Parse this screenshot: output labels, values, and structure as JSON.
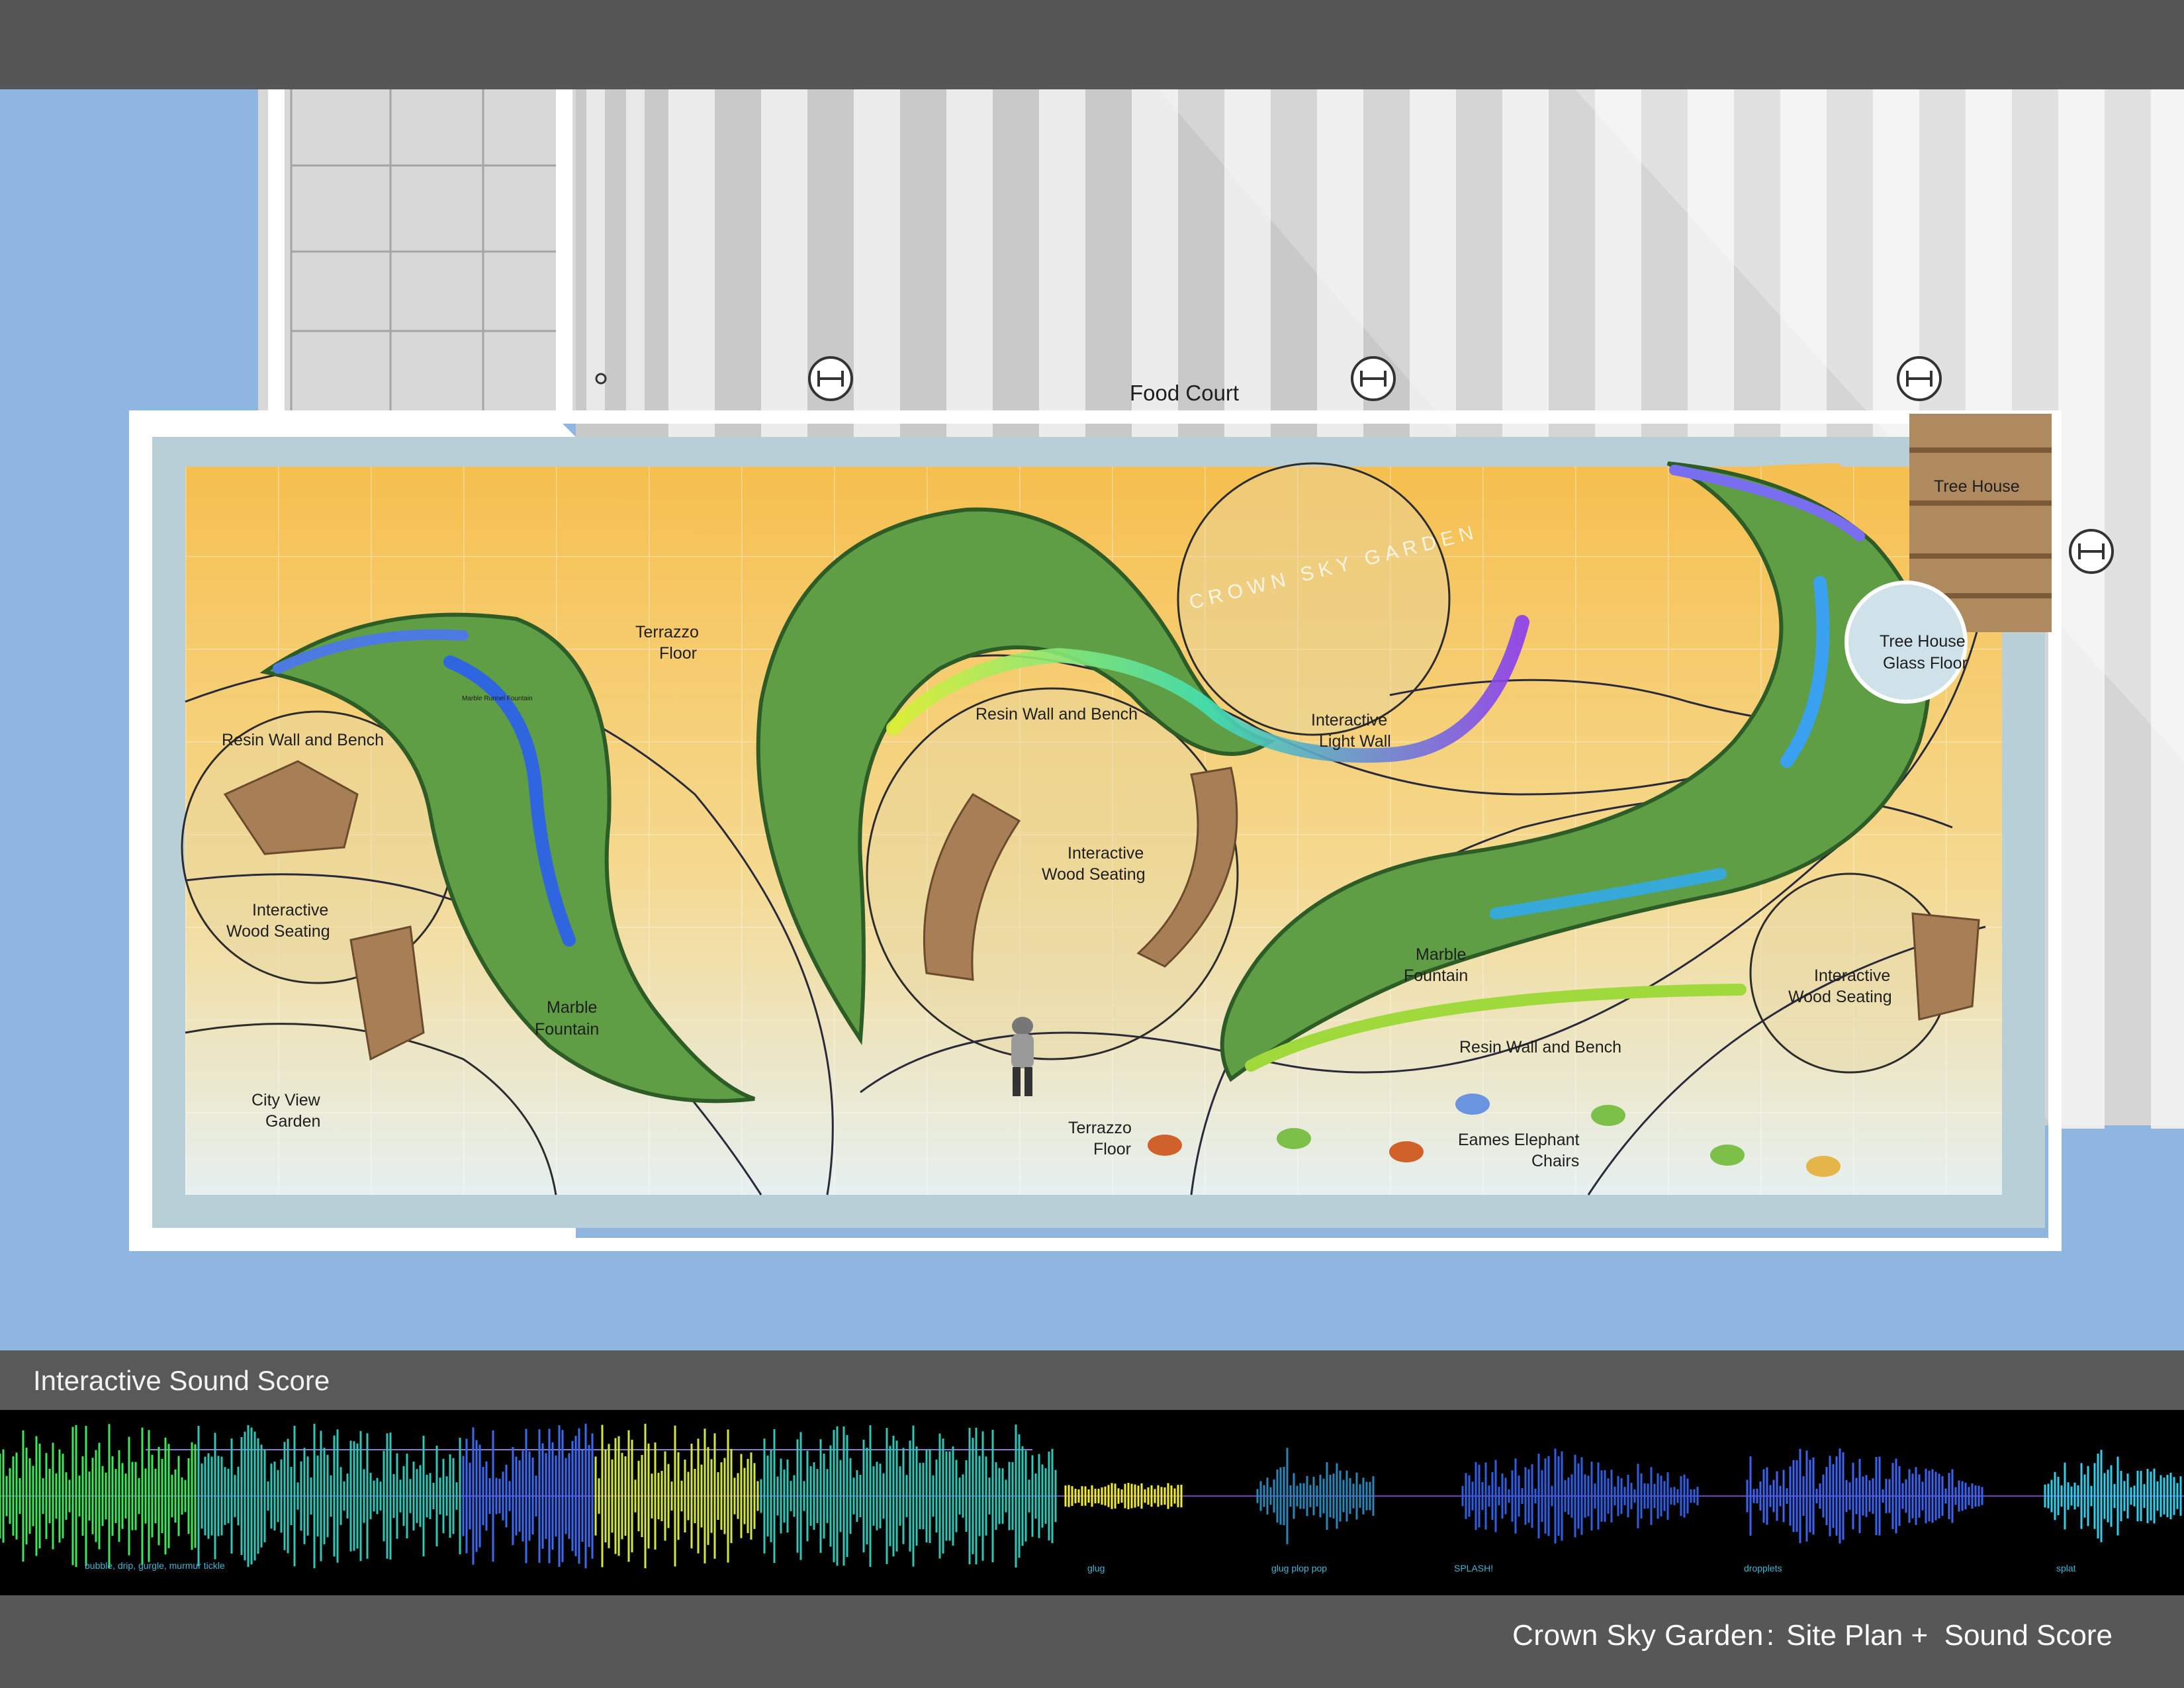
{
  "plan": {
    "food_court": "Food Court",
    "garden_stamp": "CROWN SKY GARDEN",
    "labels": {
      "tree_house": "Tree House",
      "tree_house_glass_floor_1": "Tree House",
      "tree_house_glass_floor_2": "Glass Floor",
      "terrazzo_floor_top_1": "Terrazzo",
      "terrazzo_floor_top_2": "Floor",
      "marble_runnel_fountain": "Marble Runnel Fountain",
      "resin_wall_left": "Resin Wall and Bench",
      "resin_wall_center": "Resin Wall and Bench",
      "interactive_light_wall_1": "Interactive",
      "interactive_light_wall_2": "Light Wall",
      "wood_seating_left_1": "Interactive",
      "wood_seating_left_2": "Wood Seating",
      "wood_seating_center_1": "Interactive",
      "wood_seating_center_2": "Wood Seating",
      "wood_seating_right_1": "Interactive",
      "wood_seating_right_2": "Wood Seating",
      "marble_fountain_left_1": "Marble",
      "marble_fountain_left_2": "Fountain",
      "marble_fountain_right_1": "Marble",
      "marble_fountain_right_2": "Fountain",
      "city_view_1": "City View",
      "city_view_2": "Garden",
      "resin_wall_right": "Resin Wall and Bench",
      "terrazzo_floor_bottom_1": "Terrazzo",
      "terrazzo_floor_bottom_2": "Floor",
      "eames_1": "Eames Elephant",
      "eames_2": "Chairs"
    },
    "colors": {
      "sky_blue": "#8fb6e0",
      "terrazzo_yellow": "#f4c25a",
      "planting_green": "#5f9e45",
      "resin_blue": "#3d7fe0"
    }
  },
  "sound_score": {
    "title": "Interactive Sound Score",
    "segments": [
      {
        "label": "bubble, drip, gurgle, murmur tickle",
        "color": "#33e060"
      },
      {
        "label": "glug",
        "color": "#f4ee2a"
      },
      {
        "label": "glug plop pop",
        "color": "#2a86b6"
      },
      {
        "label": "SPLASH!",
        "color": "#2f5fe0"
      },
      {
        "label": "dropplets",
        "color": "#3b63f0"
      },
      {
        "label": "splat",
        "color": "#2fd0ee"
      }
    ]
  },
  "footer": {
    "project": "Crown Sky Garden",
    "colon": ":",
    "subtitle_1": "Site Plan",
    "plus": "+",
    "subtitle_2": "Sound Score"
  }
}
